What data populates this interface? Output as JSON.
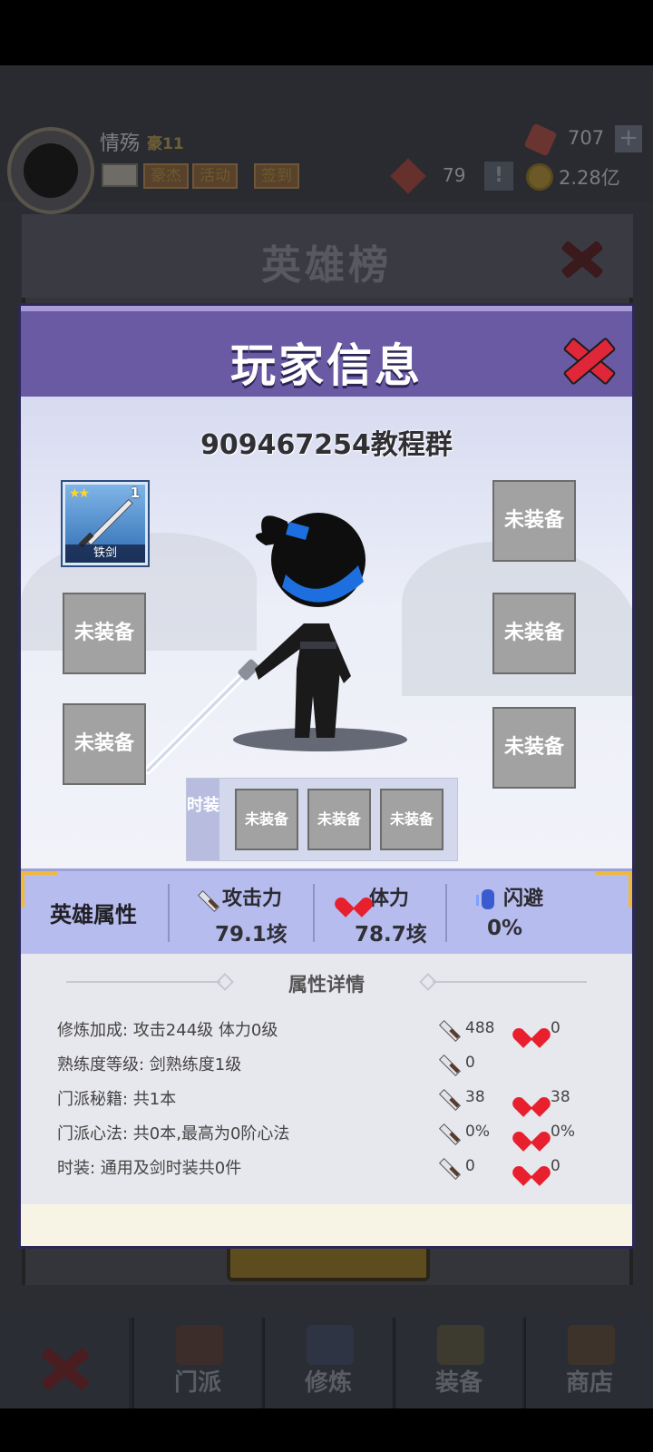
{
  "background": {
    "player_name": "情殇",
    "rank": "豪11",
    "buttons": [
      "豪杰",
      "活动",
      "签到"
    ],
    "gems": "707",
    "plus": "+",
    "tokens": "79",
    "warn": "!",
    "coins": "2.28亿",
    "panel_title": "英雄榜",
    "nav": [
      "门派",
      "修炼",
      "装备",
      "商店"
    ]
  },
  "modal": {
    "title": "玩家信息",
    "player_id": "909467254教程群",
    "weapon": {
      "name": "铁剑",
      "level": "1",
      "stars": "★★"
    },
    "empty_slot": "未装备",
    "fashion_label": "时装",
    "attributes": {
      "title": "英雄属性",
      "attack_label": "攻击力",
      "attack_value": "79.1垓",
      "stamina_label": "体力",
      "stamina_value": "78.7垓",
      "dodge_label": "闪避",
      "dodge_value": "0%"
    },
    "details": {
      "title": "属性详情",
      "rows": [
        {
          "label": "修炼加成:  攻击244级 体力0级",
          "sword": "488",
          "heart": "0"
        },
        {
          "label": "熟练度等级:  剑熟练度1级",
          "sword": "0",
          "heart": ""
        },
        {
          "label": "门派秘籍:  共1本",
          "sword": "38",
          "heart": "38"
        },
        {
          "label": "门派心法:  共0本,最高为0阶心法",
          "sword": "0%",
          "heart": "0%"
        },
        {
          "label": "时装:  通用及剑时装共0件",
          "sword": "0",
          "heart": "0"
        }
      ]
    }
  }
}
